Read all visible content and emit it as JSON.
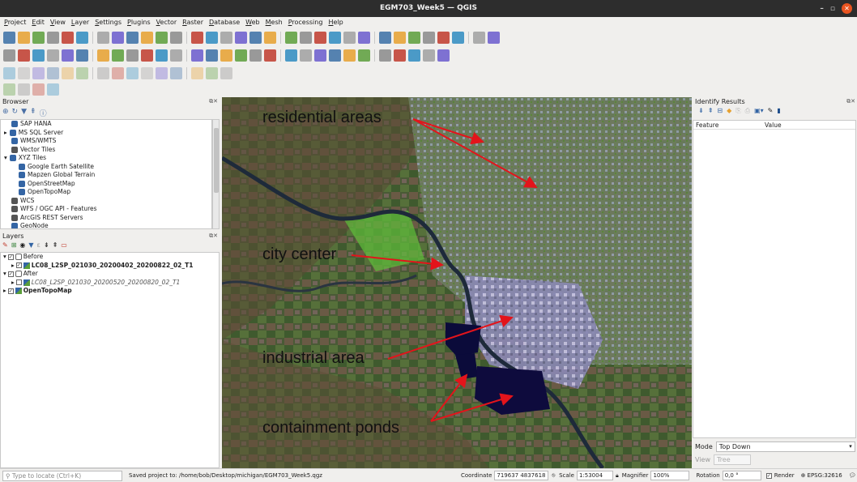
{
  "window": {
    "title": "EGM703_Week5 — QGIS",
    "minimize": "–",
    "maximize": "▫",
    "close": "✕"
  },
  "menu": [
    "Project",
    "Edit",
    "View",
    "Layer",
    "Settings",
    "Plugins",
    "Vector",
    "Raster",
    "Database",
    "Web",
    "Mesh",
    "Processing",
    "Help"
  ],
  "toolbar_icons": {
    "row1": [
      "new-project-icon",
      "open-project-icon",
      "save-project-icon",
      "save-as-icon",
      "print-layout-icon",
      "style-manager-icon",
      "pan-icon",
      "pan-to-selection-icon",
      "zoom-in-icon",
      "zoom-out-icon",
      "zoom-full-icon",
      "zoom-selection-icon",
      "zoom-layer-icon",
      "zoom-native-icon",
      "zoom-last-icon",
      "zoom-next-icon",
      "new-bookmark-icon",
      "show-bookmarks-icon",
      "temporal-controller-icon",
      "refresh-icon",
      "select-icon",
      "deselect-icon",
      "select-value-icon",
      "open-attribute-table-icon",
      "identify-icon",
      "measure-icon",
      "statistics-icon",
      "sum-icon",
      "open-field-calculator-icon",
      "map-tips-icon",
      "text-annotation-icon",
      "search-icon"
    ],
    "row2": [
      "data-source-manager-icon",
      "new-geopackage-layer-icon",
      "new-shapefile-icon",
      "new-spatialite-icon",
      "new-virtual-layer-icon",
      "add-raster-icon",
      "add-wms-icon",
      "edit-pencil-icon",
      "digitize-icon",
      "add-point-icon",
      "vertex-tool-icon",
      "delete-icon",
      "cut-icon",
      "copy-icon",
      "paste-icon",
      "undo-icon",
      "redo-icon",
      "label-icon",
      "label-pin-icon",
      "rule-label-icon",
      "diagram-icon",
      "label-show-icon",
      "label-move-icon",
      "label-rotate-icon",
      "label-change-icon",
      "georeferencer-icon",
      "python-icon",
      "terrain-icon",
      "processing-toolbox-icon"
    ],
    "row3": [
      "digitize-shape-icon",
      "circle-icon",
      "rectangle-icon",
      "regular-polygon-icon",
      "ellipse-icon",
      "split-icon",
      "reshape-icon",
      "offset-icon",
      "rotate-icon",
      "simplify-icon",
      "merge-icon",
      "fill-ring-icon",
      "delete-ring-icon",
      "delete-part-icon",
      "reshape-feature-icon"
    ],
    "row4": [
      "advanced-digitize-icon",
      "snap-icon",
      "trace-icon",
      "grid-icon"
    ]
  },
  "browser": {
    "title": "Browser",
    "items": [
      {
        "label": "SAP HANA",
        "icon": "sap-hana-icon",
        "indent": 1
      },
      {
        "label": "MS SQL Server",
        "icon": "mssql-icon",
        "indent": 0,
        "expand": "▸"
      },
      {
        "label": "WMS/WMTS",
        "icon": "wms-icon",
        "indent": 1
      },
      {
        "label": "Vector Tiles",
        "icon": "vector-tiles-icon",
        "indent": 1
      },
      {
        "label": "XYZ Tiles",
        "icon": "xyz-tiles-icon",
        "indent": 0,
        "expand": "▾"
      },
      {
        "label": "Google Earth Satellite",
        "icon": "xyz-tile-icon",
        "indent": 2
      },
      {
        "label": "Mapzen Global Terrain",
        "icon": "xyz-tile-icon",
        "indent": 2
      },
      {
        "label": "OpenStreetMap",
        "icon": "xyz-tile-icon",
        "indent": 2
      },
      {
        "label": "OpenTopoMap",
        "icon": "xyz-tile-icon",
        "indent": 2
      },
      {
        "label": "WCS",
        "icon": "wcs-icon",
        "indent": 1
      },
      {
        "label": "WFS / OGC API - Features",
        "icon": "wfs-icon",
        "indent": 1
      },
      {
        "label": "ArcGIS REST Servers",
        "icon": "arcgis-icon",
        "indent": 1
      },
      {
        "label": "GeoNode",
        "icon": "geonode-icon",
        "indent": 1
      }
    ]
  },
  "layers": {
    "title": "Layers",
    "items": [
      {
        "label": "Before",
        "type": "group",
        "checked": true,
        "bold": false,
        "italic": false,
        "indent": 0
      },
      {
        "label": "LC08_L2SP_021030_20200402_20200822_02_T1",
        "type": "raster",
        "checked": true,
        "bold": true,
        "italic": false,
        "indent": 1
      },
      {
        "label": "After",
        "type": "group",
        "checked": true,
        "bold": false,
        "italic": false,
        "indent": 0
      },
      {
        "label": "LC08_L2SP_021030_20200520_20200820_02_T1",
        "type": "raster",
        "checked": false,
        "bold": false,
        "italic": true,
        "indent": 1
      },
      {
        "label": "OpenTopoMap",
        "type": "raster",
        "checked": true,
        "bold": true,
        "italic": false,
        "indent": 0
      }
    ]
  },
  "map": {
    "annotations": {
      "residential": "residential areas",
      "city_center": "city center",
      "industrial": "industrial area",
      "ponds": "containment ponds"
    },
    "arrow_color": "#e3141b"
  },
  "identify": {
    "title": "Identify Results",
    "columns": [
      "Feature",
      "Value"
    ],
    "mode_label": "Mode",
    "mode_value": "Top Down",
    "view_label": "View",
    "view_value": "Tree"
  },
  "status": {
    "locate_placeholder": "Type to locate (Ctrl+K)",
    "message": "Saved project to: /home/bob/Desktop/michigan/EGM703_Week5.qgz",
    "coordinate_label": "Coordinate",
    "coordinate": "719637 4837618",
    "scale_label": "Scale",
    "scale": "1:53004",
    "magnifier_label": "Magnifier",
    "magnifier": "100%",
    "rotation_label": "Rotation",
    "rotation": "0,0 °",
    "render_label": "Render",
    "crs": "EPSG:32616"
  },
  "colors": {
    "titlebar": "#2d2d2d",
    "close_button": "#e95420",
    "panel_bg": "#f0efed"
  }
}
